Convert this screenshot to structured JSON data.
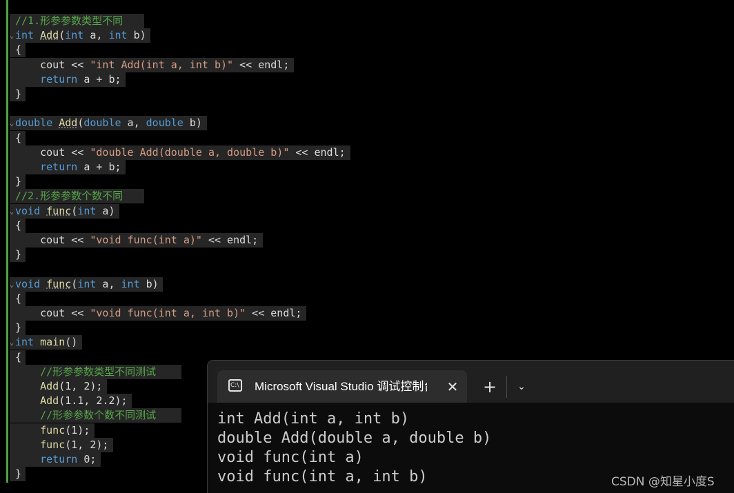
{
  "colors": {
    "background": "#000000",
    "keyword": "#569cd6",
    "function": "#dcdcaa",
    "string": "#d69d85",
    "comment": "#57a64a",
    "plain": "#dcdcdc",
    "gutter": "#4ea33f"
  },
  "editor": {
    "lines": [
      {
        "tokens": [
          {
            "c": "cm",
            "t": "//1.形参参数类型不同"
          }
        ]
      },
      {
        "fold": "⌄",
        "tokens": [
          {
            "c": "kw",
            "t": "int"
          },
          {
            "c": "pl",
            "t": " "
          },
          {
            "c": "fn-u",
            "t": "Add"
          },
          {
            "c": "pl",
            "t": "("
          },
          {
            "c": "kw",
            "t": "int"
          },
          {
            "c": "pl",
            "t": " a, "
          },
          {
            "c": "kw",
            "t": "int"
          },
          {
            "c": "pl",
            "t": " b)"
          }
        ]
      },
      {
        "tokens": [
          {
            "c": "brace",
            "t": "{"
          }
        ]
      },
      {
        "tokens": [
          {
            "c": "pl",
            "t": "    cout << "
          },
          {
            "c": "str",
            "t": "\"int Add(int a, int b)\""
          },
          {
            "c": "pl",
            "t": " << endl;"
          }
        ]
      },
      {
        "tokens": [
          {
            "c": "kw",
            "t": "    return"
          },
          {
            "c": "pl",
            "t": " a + b;"
          }
        ]
      },
      {
        "tokens": [
          {
            "c": "brace",
            "t": "}"
          }
        ]
      },
      {
        "tokens": []
      },
      {
        "fold": "⌄",
        "tokens": [
          {
            "c": "kw",
            "t": "double"
          },
          {
            "c": "pl",
            "t": " "
          },
          {
            "c": "fn-u",
            "t": "Add"
          },
          {
            "c": "pl",
            "t": "("
          },
          {
            "c": "kw",
            "t": "double"
          },
          {
            "c": "pl",
            "t": " a, "
          },
          {
            "c": "kw",
            "t": "double"
          },
          {
            "c": "pl",
            "t": " b)"
          }
        ]
      },
      {
        "tokens": [
          {
            "c": "brace",
            "t": "{"
          }
        ]
      },
      {
        "tokens": [
          {
            "c": "pl",
            "t": "    cout << "
          },
          {
            "c": "str",
            "t": "\"double Add(double a, double b)\""
          },
          {
            "c": "pl",
            "t": " << endl;"
          }
        ]
      },
      {
        "tokens": [
          {
            "c": "kw",
            "t": "    return"
          },
          {
            "c": "pl",
            "t": " a + b;"
          }
        ]
      },
      {
        "tokens": [
          {
            "c": "brace",
            "t": "}"
          }
        ]
      },
      {
        "tokens": [
          {
            "c": "cm",
            "t": "//2.形参参数个数不同"
          }
        ]
      },
      {
        "fold": "⌄",
        "tokens": [
          {
            "c": "kw",
            "t": "void"
          },
          {
            "c": "pl",
            "t": " "
          },
          {
            "c": "fn-u",
            "t": "func"
          },
          {
            "c": "pl",
            "t": "("
          },
          {
            "c": "kw",
            "t": "int"
          },
          {
            "c": "pl",
            "t": " a)"
          }
        ]
      },
      {
        "tokens": [
          {
            "c": "brace",
            "t": "{"
          }
        ]
      },
      {
        "tokens": [
          {
            "c": "pl",
            "t": "    cout << "
          },
          {
            "c": "str",
            "t": "\"void func(int a)\""
          },
          {
            "c": "pl",
            "t": " << endl;"
          }
        ]
      },
      {
        "tokens": [
          {
            "c": "brace",
            "t": "}"
          }
        ]
      },
      {
        "tokens": []
      },
      {
        "fold": "⌄",
        "tokens": [
          {
            "c": "kw",
            "t": "void"
          },
          {
            "c": "pl",
            "t": " "
          },
          {
            "c": "fn-u",
            "t": "func"
          },
          {
            "c": "pl",
            "t": "("
          },
          {
            "c": "kw",
            "t": "int"
          },
          {
            "c": "pl",
            "t": " a, "
          },
          {
            "c": "kw",
            "t": "int"
          },
          {
            "c": "pl",
            "t": " b)"
          }
        ]
      },
      {
        "tokens": [
          {
            "c": "brace",
            "t": "{"
          }
        ]
      },
      {
        "tokens": [
          {
            "c": "pl",
            "t": "    cout << "
          },
          {
            "c": "str",
            "t": "\"void func(int a, int b)\""
          },
          {
            "c": "pl",
            "t": " << endl;"
          }
        ]
      },
      {
        "tokens": [
          {
            "c": "brace",
            "t": "}"
          }
        ]
      },
      {
        "fold": "⌄",
        "tokens": [
          {
            "c": "kw",
            "t": "int"
          },
          {
            "c": "pl",
            "t": " "
          },
          {
            "c": "fn",
            "t": "main"
          },
          {
            "c": "pl",
            "t": "()"
          }
        ]
      },
      {
        "tokens": [
          {
            "c": "brace",
            "t": "{"
          }
        ]
      },
      {
        "tokens": [
          {
            "c": "cm",
            "t": "    //形参参数类型不同测试"
          }
        ]
      },
      {
        "tokens": [
          {
            "c": "fn",
            "t": "    Add"
          },
          {
            "c": "pl",
            "t": "(1, 2);"
          }
        ]
      },
      {
        "tokens": [
          {
            "c": "fn",
            "t": "    Add"
          },
          {
            "c": "pl",
            "t": "(1.1, 2.2);"
          }
        ]
      },
      {
        "tokens": [
          {
            "c": "cm",
            "t": "    //形参参数个数不同测试"
          }
        ]
      },
      {
        "tokens": [
          {
            "c": "fn",
            "t": "    func"
          },
          {
            "c": "pl",
            "t": "(1);"
          }
        ]
      },
      {
        "tokens": [
          {
            "c": "fn",
            "t": "    func"
          },
          {
            "c": "pl",
            "t": "(1, 2);"
          }
        ]
      },
      {
        "tokens": [
          {
            "c": "kw",
            "t": "    return"
          },
          {
            "c": "pl",
            "t": " 0;"
          }
        ]
      },
      {
        "tokens": [
          {
            "c": "brace",
            "t": "}"
          }
        ]
      }
    ]
  },
  "console": {
    "tab_title": "Microsoft Visual Studio 调试控制台",
    "tab_icon_text": "C:\\",
    "close_glyph": "✕",
    "new_tab_glyph": "+",
    "dropdown_glyph": "⌄",
    "output": [
      "int Add(int a, int b)",
      "double Add(double a, double b)",
      "void func(int a)",
      "void func(int a, int b)"
    ]
  },
  "watermark": "CSDN @知星小度S"
}
